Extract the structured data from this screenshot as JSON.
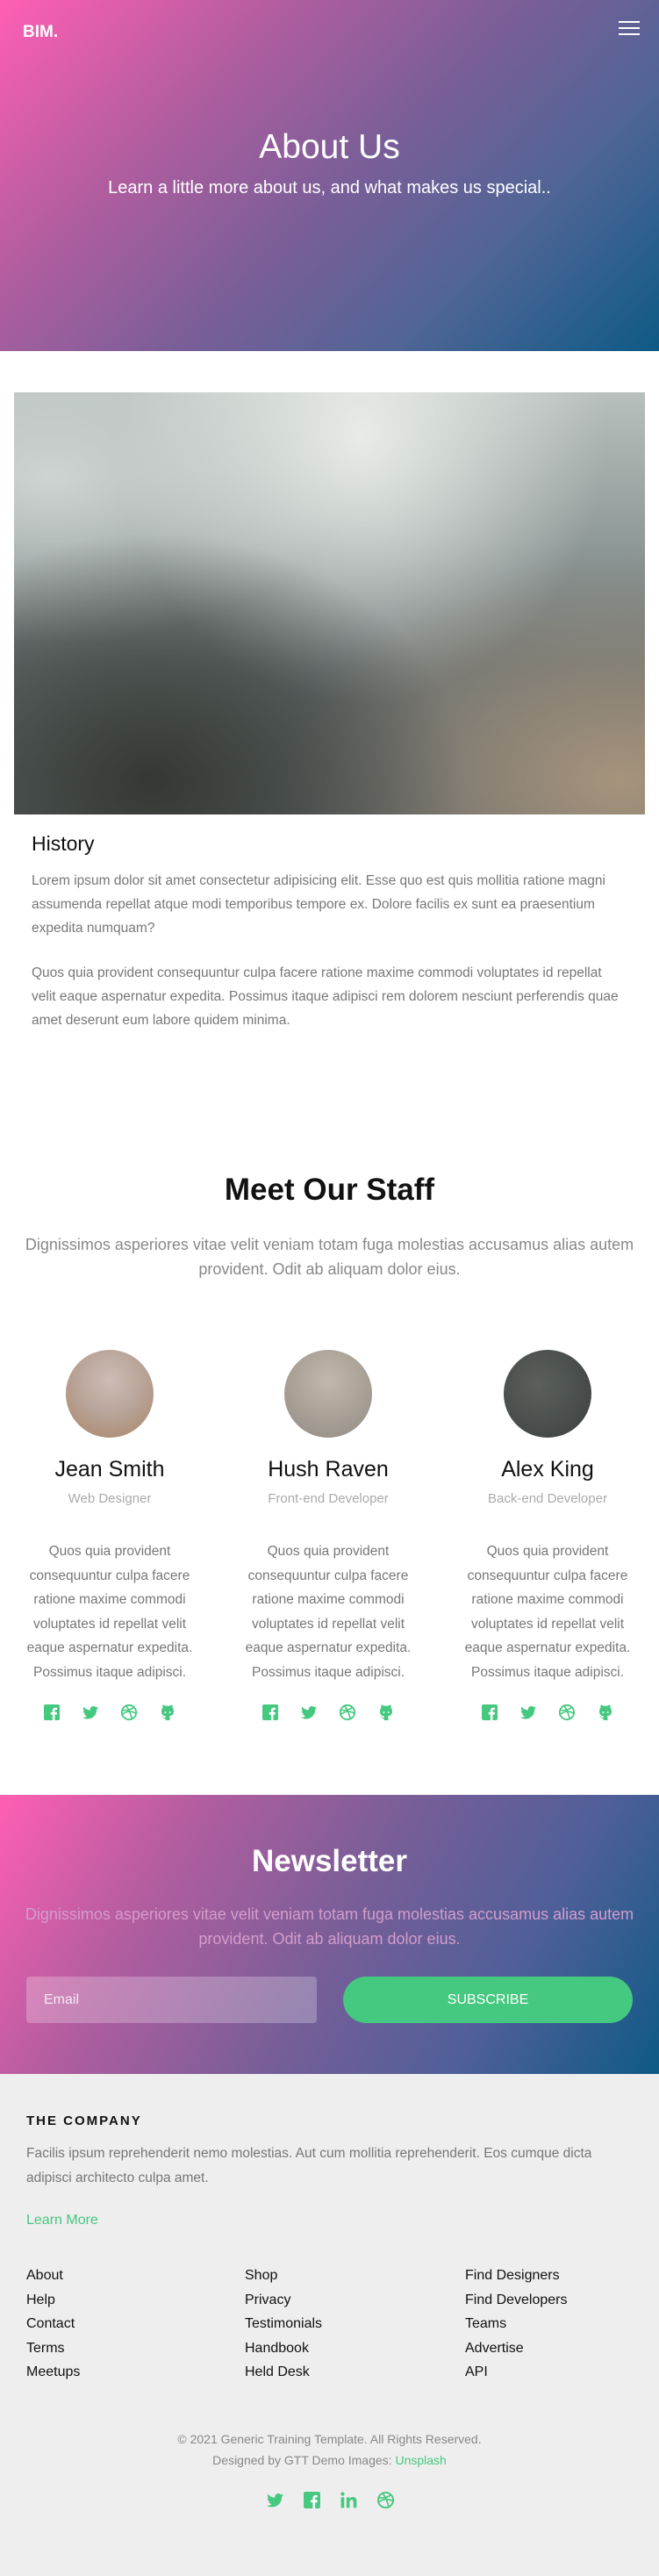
{
  "header": {
    "brand": "BIM.",
    "menu_icon": "hamburger-menu-icon"
  },
  "hero": {
    "title": "About Us",
    "subtitle": "Learn a little more about us, and what makes us special.."
  },
  "history": {
    "heading": "History",
    "paragraphs": [
      "Lorem ipsum dolor sit amet consectetur adipisicing elit. Esse quo est quis mollitia ratione magni assumenda repellat atque modi temporibus tempore ex. Dolore facilis ex sunt ea praesentium expedita numquam?",
      "Quos quia provident consequuntur culpa facere ratione maxime commodi voluptates id repellat velit eaque aspernatur expedita. Possimus itaque adipisci rem dolorem nesciunt perferendis quae amet deserunt eum labore quidem minima."
    ]
  },
  "staff": {
    "heading": "Meet Our Staff",
    "intro": "Dignissimos asperiores vitae velit veniam totam fuga molestias accusamus alias autem provident. Odit ab aliquam dolor eius.",
    "members": [
      {
        "name": "Jean Smith",
        "role": "Web Designer",
        "bio": "Quos quia provident consequuntur culpa facere ratione maxime commodi voluptates id repellat velit eaque aspernatur expedita. Possimus itaque adipisci.",
        "social_icons": [
          "facebook-icon",
          "twitter-icon",
          "dribbble-icon",
          "github-icon"
        ]
      },
      {
        "name": "Hush Raven",
        "role": "Front-end Developer",
        "bio": "Quos quia provident consequuntur culpa facere ratione maxime commodi voluptates id repellat velit eaque aspernatur expedita. Possimus itaque adipisci.",
        "social_icons": [
          "facebook-icon",
          "twitter-icon",
          "dribbble-icon",
          "github-icon"
        ]
      },
      {
        "name": "Alex King",
        "role": "Back-end Developer",
        "bio": "Quos quia provident consequuntur culpa facere ratione maxime commodi voluptates id repellat velit eaque aspernatur expedita. Possimus itaque adipisci.",
        "social_icons": [
          "facebook-icon",
          "twitter-icon",
          "dribbble-icon",
          "github-icon"
        ]
      }
    ]
  },
  "newsletter": {
    "title": "Newsletter",
    "text": "Dignissimos asperiores vitae velit veniam totam fuga molestias accusamus alias autem provident. Odit ab aliquam dolor eius.",
    "email_placeholder": "Email",
    "subscribe_label": "SUBSCRIBE"
  },
  "footer": {
    "heading": "THE COMPANY",
    "text": "Facilis ipsum reprehenderit nemo molestias. Aut cum mollitia reprehenderit. Eos cumque dicta adipisci architecto culpa amet.",
    "learn_more": "Learn More",
    "columns": [
      [
        "About",
        "Help",
        "Contact",
        "Terms",
        "Meetups"
      ],
      [
        "Shop",
        "Privacy",
        "Testimonials",
        "Handbook",
        "Held Desk"
      ],
      [
        "Find Designers",
        "Find Developers",
        "Teams",
        "Advertise",
        "API"
      ]
    ],
    "copyright": "© 2021 Generic Training Template. All Rights Reserved.",
    "designed_by": "Designed by GTT Demo Images:",
    "images_link": "Unsplash",
    "social_icons": [
      "twitter-icon",
      "facebook-icon",
      "linkedin-icon",
      "dribbble-icon"
    ]
  },
  "colors": {
    "accent_green": "#45c87f",
    "gradient_pink": "#ff5fb3",
    "gradient_blue": "#0e5a86"
  }
}
